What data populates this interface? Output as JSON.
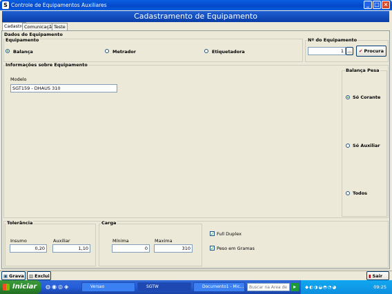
{
  "window": {
    "title": "Controle de Equipamentos Auxiliares"
  },
  "header": {
    "title": "Cadastramento de Equipamento"
  },
  "tabs": [
    {
      "label": "Cadastro"
    },
    {
      "label": "Comunicação"
    },
    {
      "label": "Teste"
    }
  ],
  "dados": {
    "section_label": "Dados do Equipamento",
    "group_label": "Equipamento",
    "options": [
      {
        "label": "Balança",
        "selected": true
      },
      {
        "label": "Metrador",
        "selected": false
      },
      {
        "label": "Etiquetadora",
        "selected": false
      }
    ],
    "numero_label": "Nº do Equipamento",
    "numero_value": "1",
    "browse_label": "...",
    "procura_label": "Procura"
  },
  "info": {
    "section_label": "Informações sobre Equipamento",
    "modelo_label": "Modelo",
    "modelo_value": "SGT159 - DHAUS 310"
  },
  "balanca_pesa": {
    "label": "Balança Pesa",
    "options": [
      {
        "label": "Só Corante",
        "selected": true
      },
      {
        "label": "Só Auxiliar",
        "selected": false
      },
      {
        "label": "Todos",
        "selected": false
      }
    ]
  },
  "tolerancia": {
    "label": "Tolerância",
    "insumo_label": "Insumo",
    "insumo_value": "0,20",
    "auxiliar_label": "Auxiliar",
    "auxiliar_value": "1,10"
  },
  "carga": {
    "label": "Carga",
    "minima_label": "Mínima",
    "minima_value": "0",
    "maxima_label": "Maxima",
    "maxima_value": "310"
  },
  "flags": {
    "full_duplex_label": "Full Duplex",
    "full_duplex_checked": true,
    "peso_gramas_label": "Peso em Gramas",
    "peso_gramas_checked": true
  },
  "footer": {
    "grava_label": "Grava",
    "exclui_label": "Exclui",
    "sair_label": "Sair"
  },
  "taskbar": {
    "start_label": "Iniciar",
    "tasks": [
      {
        "label": "Versao"
      },
      {
        "label": "SGTW"
      },
      {
        "label": "Documento1 - Mic..."
      }
    ],
    "search_placeholder": "Buscar na Área de Tr...",
    "clock": "09:25"
  },
  "colors": {
    "titlebar": "#0348c9",
    "header": "#0a3ea8",
    "window_bg": "#ece9d8",
    "taskbar": "#245edb",
    "start": "#2e8b2e"
  }
}
